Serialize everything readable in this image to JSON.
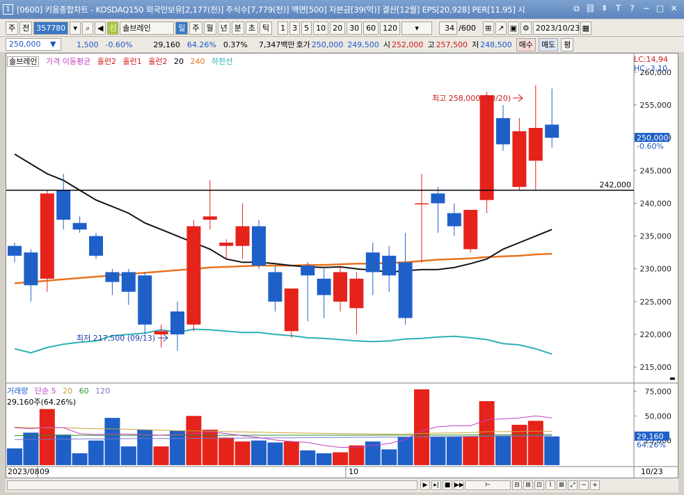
{
  "window": {
    "number": "1",
    "title": "[0600] 키움종합차트 - KOSDAQ150 외국인보유[2,177(천)] 주식수[7,779(천)] 액면[500] 자본금[39(억)] 결산[12월] EPS[20,928] PER[11.95] 시"
  },
  "toolbar": {
    "mode": "주",
    "prev": "전",
    "code": "357780",
    "stock_name": "솔브레인",
    "periods": [
      "일",
      "주",
      "월",
      "년",
      "분",
      "초",
      "틱"
    ],
    "numbers": [
      "1",
      "3",
      "5",
      "10",
      "20",
      "30",
      "60",
      "120"
    ],
    "count": "34",
    "total": "/600",
    "date": "2023/10/23",
    "badge": "신"
  },
  "quote": {
    "price": "250,000",
    "change": "1,500",
    "pct": "-0.60%",
    "volume": "29,160",
    "vol_pct": "64.26%",
    "turnover": "0.37%",
    "amount": "7,347백만",
    "bid_label": "호가",
    "ask": "250,000",
    "bid": "249,500",
    "open_label": "시",
    "open": "252,000",
    "high_label": "고",
    "high": "257,500",
    "low_label": "저",
    "low": "248,500",
    "buy": "매수",
    "sell": "매도",
    "eval": "평"
  },
  "legend": {
    "name": "솔브레인",
    "items": [
      "가격 이동평균",
      "홀런2",
      "홀런1",
      "홀런2",
      "20",
      "240",
      "하한선"
    ]
  },
  "vlegend": {
    "items": [
      "거래량",
      "단순 5",
      "20",
      "60",
      "120"
    ],
    "info": "29,160주(64.26%)"
  },
  "annotations": {
    "high": "최고 258,000 (10/20)",
    "low": "최저 217,500 (09/13)",
    "hline": "242,000",
    "lc": "LC:14,94",
    "hc": "HC:-3,10",
    "cur_price": "250,000",
    "cur_pct": "-0.60%",
    "vol_cur": "29,160",
    "vol_pct": "64.26%"
  },
  "xaxis": {
    "start": "2023/08",
    "m1": "09",
    "m2": "10",
    "end": "10/23"
  },
  "chart_data": [
    {
      "type": "candlestick",
      "x_axis": [
        "2023/08",
        "09",
        "10"
      ],
      "yticks": [
        215000,
        220000,
        225000,
        230000,
        235000,
        240000,
        245000,
        250000,
        255000,
        260000
      ],
      "ylim": [
        213000,
        262000
      ],
      "candles": [
        {
          "o": 233500,
          "h": 234000,
          "l": 231000,
          "c": 232000
        },
        {
          "o": 232500,
          "h": 233000,
          "l": 225000,
          "c": 227500
        },
        {
          "o": 228500,
          "h": 242000,
          "l": 226500,
          "c": 241500
        },
        {
          "o": 242000,
          "h": 244500,
          "l": 236000,
          "c": 237500
        },
        {
          "o": 237000,
          "h": 238000,
          "l": 235500,
          "c": 236000
        },
        {
          "o": 235000,
          "h": 235500,
          "l": 231500,
          "c": 232000
        },
        {
          "o": 229500,
          "h": 230000,
          "l": 226000,
          "c": 228000
        },
        {
          "o": 229500,
          "h": 230000,
          "l": 224500,
          "c": 226500
        },
        {
          "o": 229000,
          "h": 229500,
          "l": 220000,
          "c": 221500
        },
        {
          "o": 220000,
          "h": 221500,
          "l": 218000,
          "c": 220500
        },
        {
          "o": 223500,
          "h": 225000,
          "l": 217500,
          "c": 220000
        },
        {
          "o": 221500,
          "h": 237500,
          "l": 220500,
          "c": 236500
        },
        {
          "o": 237500,
          "h": 243500,
          "l": 236000,
          "c": 238000
        },
        {
          "o": 233500,
          "h": 234500,
          "l": 231500,
          "c": 234000
        },
        {
          "o": 233500,
          "h": 240000,
          "l": 231500,
          "c": 236500
        },
        {
          "o": 236500,
          "h": 237500,
          "l": 230000,
          "c": 230500
        },
        {
          "o": 229500,
          "h": 230500,
          "l": 223500,
          "c": 225000
        },
        {
          "o": 220500,
          "h": 227000,
          "l": 219500,
          "c": 227000
        },
        {
          "o": 230500,
          "h": 231000,
          "l": 222000,
          "c": 229000
        },
        {
          "o": 228500,
          "h": 230000,
          "l": 222500,
          "c": 226000
        },
        {
          "o": 225000,
          "h": 230500,
          "l": 223500,
          "c": 229500
        },
        {
          "o": 224000,
          "h": 229500,
          "l": 220000,
          "c": 228500
        },
        {
          "o": 232500,
          "h": 234000,
          "l": 226000,
          "c": 229500
        },
        {
          "o": 232000,
          "h": 233500,
          "l": 226500,
          "c": 229000
        },
        {
          "o": 231000,
          "h": 235500,
          "l": 221500,
          "c": 222500
        },
        {
          "o": 240000,
          "h": 244500,
          "l": 231000,
          "c": 240000
        },
        {
          "o": 241500,
          "h": 242500,
          "l": 235500,
          "c": 240000
        },
        {
          "o": 238500,
          "h": 240000,
          "l": 235000,
          "c": 236500
        },
        {
          "o": 233000,
          "h": 239000,
          "l": 232500,
          "c": 239000
        },
        {
          "o": 240500,
          "h": 257000,
          "l": 238500,
          "c": 256500
        },
        {
          "o": 253000,
          "h": 255000,
          "l": 248000,
          "c": 249000
        },
        {
          "o": 242500,
          "h": 253000,
          "l": 242000,
          "c": 251000
        },
        {
          "o": 246500,
          "h": 258000,
          "l": 242000,
          "c": 251500
        },
        {
          "o": 252000,
          "h": 257500,
          "l": 248500,
          "c": 250000
        }
      ],
      "ma20": [
        247500,
        246000,
        244500,
        243500,
        242000,
        240500,
        239500,
        238500,
        237000,
        236000,
        235000,
        234000,
        233000,
        231500,
        231000,
        231000,
        230800,
        230500,
        230300,
        230200,
        230300,
        230000,
        229800,
        229500,
        229700,
        229900,
        229900,
        230200,
        230800,
        231500,
        233000,
        234000,
        235000,
        236000
      ],
      "ma240": [
        227800,
        228000,
        228200,
        228400,
        228600,
        228800,
        229000,
        229200,
        229400,
        229600,
        229800,
        230000,
        230200,
        230300,
        230400,
        230500,
        230500,
        230500,
        230600,
        230600,
        230700,
        230800,
        230800,
        230900,
        231000,
        231200,
        231400,
        231500,
        231600,
        231800,
        231900,
        232000,
        232200,
        232300
      ],
      "lower_band": [
        217800,
        217200,
        218000,
        218500,
        218800,
        219000,
        219800,
        220000,
        220200,
        220700,
        220300,
        220800,
        220700,
        220500,
        220300,
        220300,
        220000,
        219800,
        219500,
        219400,
        219200,
        219000,
        218900,
        219000,
        219300,
        219400,
        219600,
        219700,
        219500,
        219200,
        218600,
        218400,
        217800,
        217000
      ],
      "hline": 242000
    },
    {
      "type": "bar",
      "title": "거래량",
      "yticks": [
        25000,
        50000,
        75000
      ],
      "ylim": [
        0,
        82000
      ],
      "volume": [
        17000,
        33000,
        57000,
        31000,
        12000,
        25000,
        48000,
        19000,
        36000,
        19000,
        35000,
        50000,
        36000,
        28000,
        24000,
        25000,
        23000,
        24000,
        15000,
        12000,
        13000,
        20000,
        24000,
        16000,
        29000,
        77000,
        29000,
        29000,
        29000,
        65000,
        30000,
        41000,
        45000,
        29160
      ],
      "ma5": [
        38000,
        37000,
        38500,
        38000,
        32000,
        31000,
        31500,
        31500,
        30800,
        30500,
        31000,
        32000,
        34000,
        32000,
        30000,
        28000,
        25500,
        24000,
        23000,
        20000,
        18000,
        18000,
        20000,
        22000,
        26000,
        35000,
        39000,
        40000,
        40000,
        46000,
        47000,
        48000,
        50000,
        48000
      ],
      "ma20": [
        38500,
        38000,
        38000,
        38000,
        37500,
        37000,
        36800,
        36500,
        36000,
        35500,
        35000,
        34800,
        34500,
        34000,
        33800,
        33500,
        33000,
        32800,
        32500,
        32200,
        32000,
        31800,
        31700,
        31500,
        31700,
        32200,
        32500,
        32700,
        33000,
        34000,
        34000,
        34200,
        34500,
        34500
      ],
      "ma60": [
        30000,
        30100,
        30200,
        30300,
        30300,
        30300,
        30300,
        30300,
        30300,
        30300,
        30300,
        30300,
        30300,
        30300,
        30400,
        30400,
        30400,
        30400,
        30400,
        30400,
        30400,
        30400,
        30400,
        30500,
        30500,
        30500,
        30600,
        30600,
        30700,
        30700,
        30800,
        30800,
        30900,
        31000
      ],
      "ma120": [
        26000,
        26200,
        26400,
        26500,
        26600,
        26700,
        26800,
        26900,
        27000,
        27000,
        27100,
        27200,
        27300,
        27400,
        27500,
        27600,
        27700,
        27800,
        27900,
        28000,
        28100,
        28200,
        28300,
        28400,
        28500,
        28600,
        28800,
        29000,
        29200,
        29400,
        29500,
        29600,
        29700,
        29800
      ]
    }
  ],
  "colors": {
    "up": "#e5231b",
    "down": "#1f60c8",
    "ma20": "#141414",
    "ma240": "#e8731e",
    "lower": "#2cb0b4",
    "vol_ma5": "#c13ec0",
    "vol_ma20": "#c8a234",
    "vol_ma60": "#2b8f2b",
    "vol_ma120": "#7777cc"
  }
}
